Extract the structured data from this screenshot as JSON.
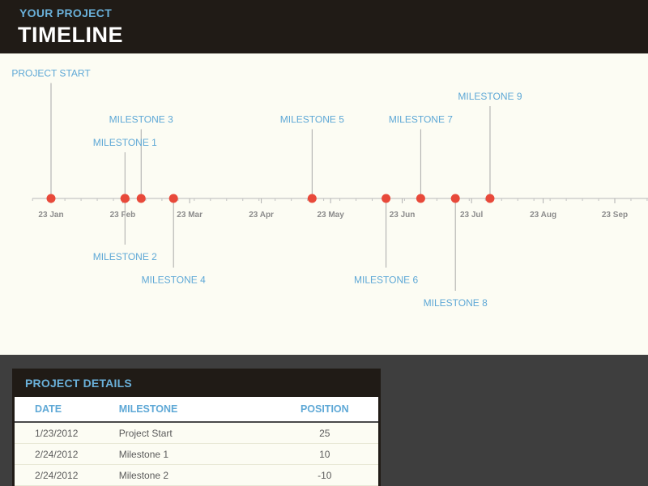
{
  "header": {
    "kicker": "YOUR PROJECT",
    "title": "TIMELINE"
  },
  "colors": {
    "header_bg": "#201b16",
    "accent_blue": "#5ea8d6",
    "marker_red": "#e8493a",
    "canvas_bg": "#fcfcf3",
    "page_bg": "#3e3e3e"
  },
  "chart_data": {
    "type": "scatter",
    "x_axis": {
      "start": "2012-01-01",
      "end": "2012-10-01",
      "tick_labels": [
        {
          "date": "2012-01-23",
          "label": "23 Jan"
        },
        {
          "date": "2012-02-23",
          "label": "23 Feb"
        },
        {
          "date": "2012-03-23",
          "label": "23 Mar"
        },
        {
          "date": "2012-04-23",
          "label": "23 Apr"
        },
        {
          "date": "2012-05-23",
          "label": "23 May"
        },
        {
          "date": "2012-06-23",
          "label": "23 Jun"
        },
        {
          "date": "2012-07-23",
          "label": "23 Jul"
        },
        {
          "date": "2012-08-23",
          "label": "23 Aug"
        },
        {
          "date": "2012-09-23",
          "label": "23 Sep"
        }
      ]
    },
    "y_range": [
      -25,
      25
    ],
    "milestones": [
      {
        "label": "PROJECT START",
        "date": "2012-01-23",
        "position": 25
      },
      {
        "label": "MILESTONE  1",
        "date": "2012-02-24",
        "position": 10
      },
      {
        "label": "MILESTONE  2",
        "date": "2012-02-24",
        "position": -10
      },
      {
        "label": "MILESTONE  3",
        "date": "2012-03-02",
        "position": 15
      },
      {
        "label": "MILESTONE  4",
        "date": "2012-03-16",
        "position": -15
      },
      {
        "label": "MILESTONE  5",
        "date": "2012-05-15",
        "position": 15
      },
      {
        "label": "MILESTONE  6",
        "date": "2012-06-16",
        "position": -15
      },
      {
        "label": "MILESTONE  7",
        "date": "2012-07-01",
        "position": 15
      },
      {
        "label": "MILESTONE  8",
        "date": "2012-07-16",
        "position": -20
      },
      {
        "label": "MILESTONE  9",
        "date": "2012-07-31",
        "position": 20
      }
    ]
  },
  "details": {
    "title": "PROJECT DETAILS",
    "columns": {
      "date": "DATE",
      "milestone": "MILESTONE",
      "position": "POSITION"
    },
    "rows": [
      {
        "date": "1/23/2012",
        "milestone": "Project Start",
        "position": "25"
      },
      {
        "date": "2/24/2012",
        "milestone": "Milestone 1",
        "position": "10"
      },
      {
        "date": "2/24/2012",
        "milestone": "Milestone 2",
        "position": "-10"
      }
    ]
  }
}
